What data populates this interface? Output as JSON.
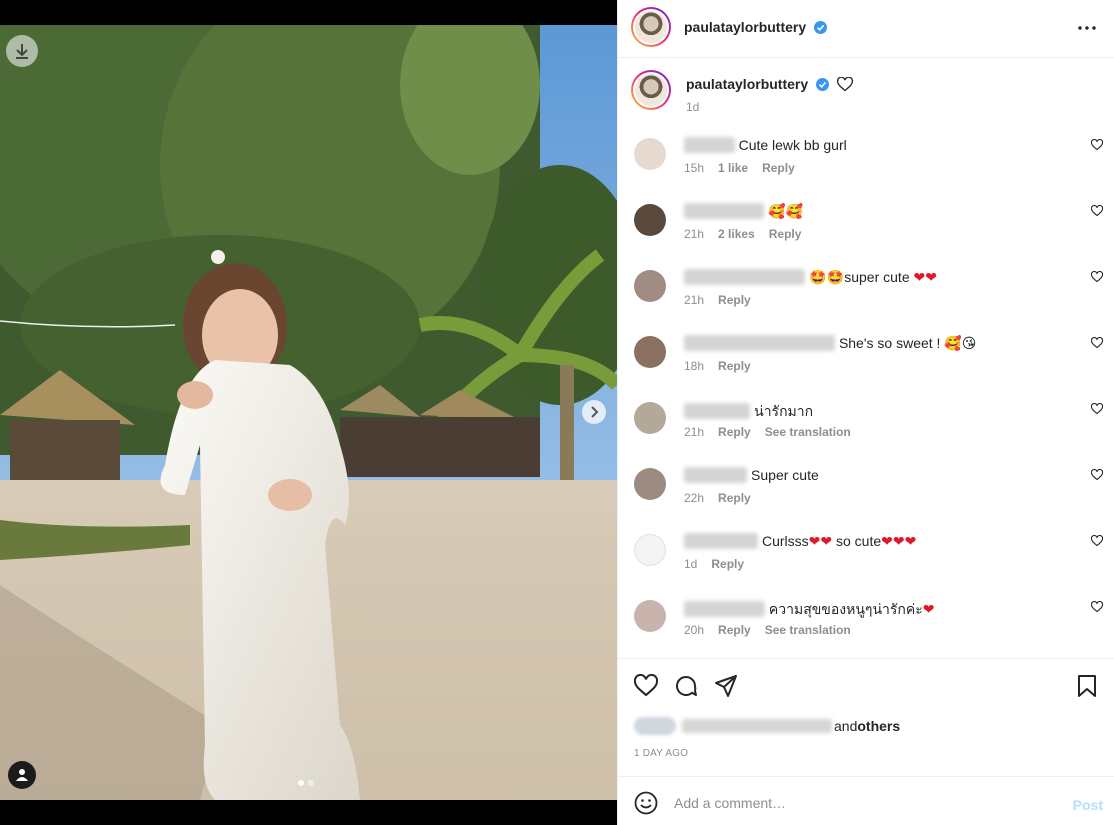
{
  "post": {
    "username": "paulataylorbuttery",
    "caption_time": "1d",
    "verified": true
  },
  "comments": [
    {
      "text": "Cute lewk bb gurl",
      "time": "15h",
      "likes": "1 like",
      "reply": "Reply",
      "avatar_color": "#e6d9cf"
    },
    {
      "text": "🥰🥰",
      "time": "21h",
      "likes": "2 likes",
      "reply": "Reply",
      "avatar_color": "#5a4a3e"
    },
    {
      "text_a": "🤩🤩",
      "text_b": "super cute ",
      "text_c": "❤❤",
      "time": "21h",
      "reply": "Reply",
      "avatar_color": "#a08c82"
    },
    {
      "text_a": "She's so sweet ! ",
      "text_b": "🥰😘",
      "time": "18h",
      "reply": "Reply",
      "avatar_color": "#8a7060"
    },
    {
      "text": "น่ารักมาก",
      "time": "21h",
      "reply": "Reply",
      "translate": "See translation",
      "avatar_color": "#b4a898"
    },
    {
      "text": "Super cute",
      "time": "22h",
      "reply": "Reply",
      "avatar_color": "#9c8b80"
    },
    {
      "text_a": "Curlsss",
      "text_b": "❤❤",
      "text_c": " so cute",
      "text_d": "❤❤❤",
      "time": "1d",
      "reply": "Reply",
      "avatar_color": "#f4f4f4"
    },
    {
      "text_a": "ความสุขของหนูๆน่ารักค่ะ",
      "text_b": "❤",
      "time": "20h",
      "reply": "Reply",
      "translate": "See translation",
      "avatar_color": "#c8b4ac"
    }
  ],
  "likes": {
    "suffix_a": " and ",
    "suffix_b": "others"
  },
  "timestamp": "1 DAY AGO",
  "composer": {
    "placeholder": "Add a comment…",
    "post_label": "Post"
  },
  "colors": {
    "link_blue": "#b2dffc",
    "verified_blue": "#3897f0",
    "heart_red": "#e0162b"
  },
  "icons": [
    "download-icon",
    "next-arrow-icon",
    "user-tag-icon",
    "verified-icon",
    "more-icon",
    "heart-icon",
    "comment-icon",
    "share-icon",
    "save-icon",
    "smile-icon"
  ]
}
